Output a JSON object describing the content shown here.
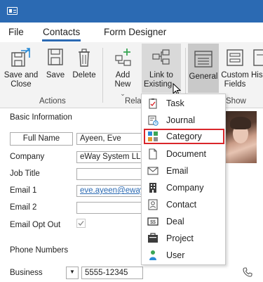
{
  "menu": {
    "tabs": [
      "File",
      "Contacts",
      "Form Designer"
    ]
  },
  "ribbon": {
    "buttons": {
      "save_close": [
        "Save and",
        "Close"
      ],
      "save": "Save",
      "delete": "Delete",
      "add_new": "Add New",
      "link_existing": [
        "Link to",
        "Existing"
      ],
      "general": "General",
      "custom_fields": [
        "Custom",
        "Fields"
      ],
      "history_partial": "His"
    },
    "groups": {
      "actions": "Actions",
      "related_partial": "Rela",
      "show_partial": "Show"
    }
  },
  "form": {
    "basic_info": "Basic Information",
    "full_name_button": "Full Name",
    "full_name_value": "Ayeen, Eve",
    "company_label": "Company",
    "company_value": "eWay System LLC",
    "job_title_label": "Job Title",
    "email1_label": "Email 1",
    "email1_value": "eve.ayeen@eway",
    "email2_label": "Email 2",
    "email_opt_out_label": "Email Opt Out",
    "email_opt_out_checked": true,
    "phone_numbers": "Phone Numbers",
    "business_label": "Business",
    "business_value": "5555-12345"
  },
  "dropdown": {
    "items": [
      "Task",
      "Journal",
      "Category",
      "Document",
      "Email",
      "Company",
      "Contact",
      "Deal",
      "Project",
      "User"
    ],
    "highlighted": "Category"
  },
  "colors": {
    "titlebar": "#2b6ab3",
    "highlight_border": "#d9262b",
    "accent": "#2b6ab3"
  }
}
